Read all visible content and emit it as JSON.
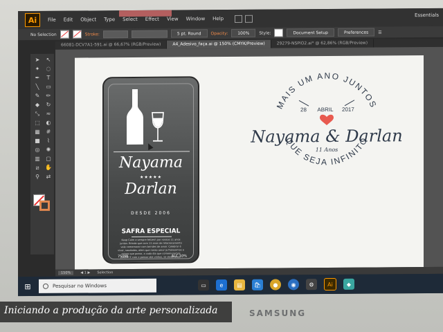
{
  "menubar": {
    "logo": "Ai",
    "items": [
      "File",
      "Edit",
      "Object",
      "Type",
      "Select",
      "Effect",
      "View",
      "Window",
      "Help"
    ],
    "workspace": "Essentials"
  },
  "control": {
    "selection": "No Selection",
    "stroke_label": "Stroke:",
    "brush": "5 pt. Round",
    "opacity_label": "Opacity:",
    "opacity_value": "100%",
    "style_label": "Style:",
    "doc_setup": "Document Setup",
    "preferences": "Preferences"
  },
  "tabs": [
    {
      "label": "66081-DCV7A1-591.ai @ 66,67% (RGB/Preview)",
      "active": false
    },
    {
      "label": "A4_Adesivo_faça.ai @ 150% (CMYK/Preview)",
      "active": true
    },
    {
      "label": "29279-NSPIO2.ai* @ 62,86% (RGB/Preview)",
      "active": false
    }
  ],
  "label_art": {
    "name1": "Nayama",
    "stars": "★★★★★",
    "name2": "Darlan",
    "since": "DESDE 2006",
    "safra": "SAFRA ESPECIAL",
    "body": "Keep Calm e sempre felizes! por nossos 11 anos juntos. Brinde que com 11 anos de relacionamento vale comemorar com brindes de amor. Celebrar é viver, saudades, alem que nosso amor ja fizéssemos e coisas que posso, a cada dia que comemoramos juntos. E com o passar dos vinhos, se deixe levar.",
    "volume": "750ML",
    "alc": "ALC 10%"
  },
  "seal": {
    "top_arc": "MAIS UM ANO JUNTOS",
    "day": "28",
    "month": "ABRIL",
    "year": "2017",
    "names": "Nayama & Darlan",
    "years": "11 Anos",
    "bottom_arc": "QUE SEJA INFINITO"
  },
  "status": {
    "zoom": "150%",
    "tool": "Selection"
  },
  "taskbar": {
    "search_placeholder": "Pesquisar no Windows"
  },
  "caption": "Iniciando a produção da arte personalizada",
  "brand": "SAMSUNG",
  "colors": {
    "accent_orange": "#ff9a00",
    "heart": "#e85a4f",
    "label_dark": "#474949"
  }
}
